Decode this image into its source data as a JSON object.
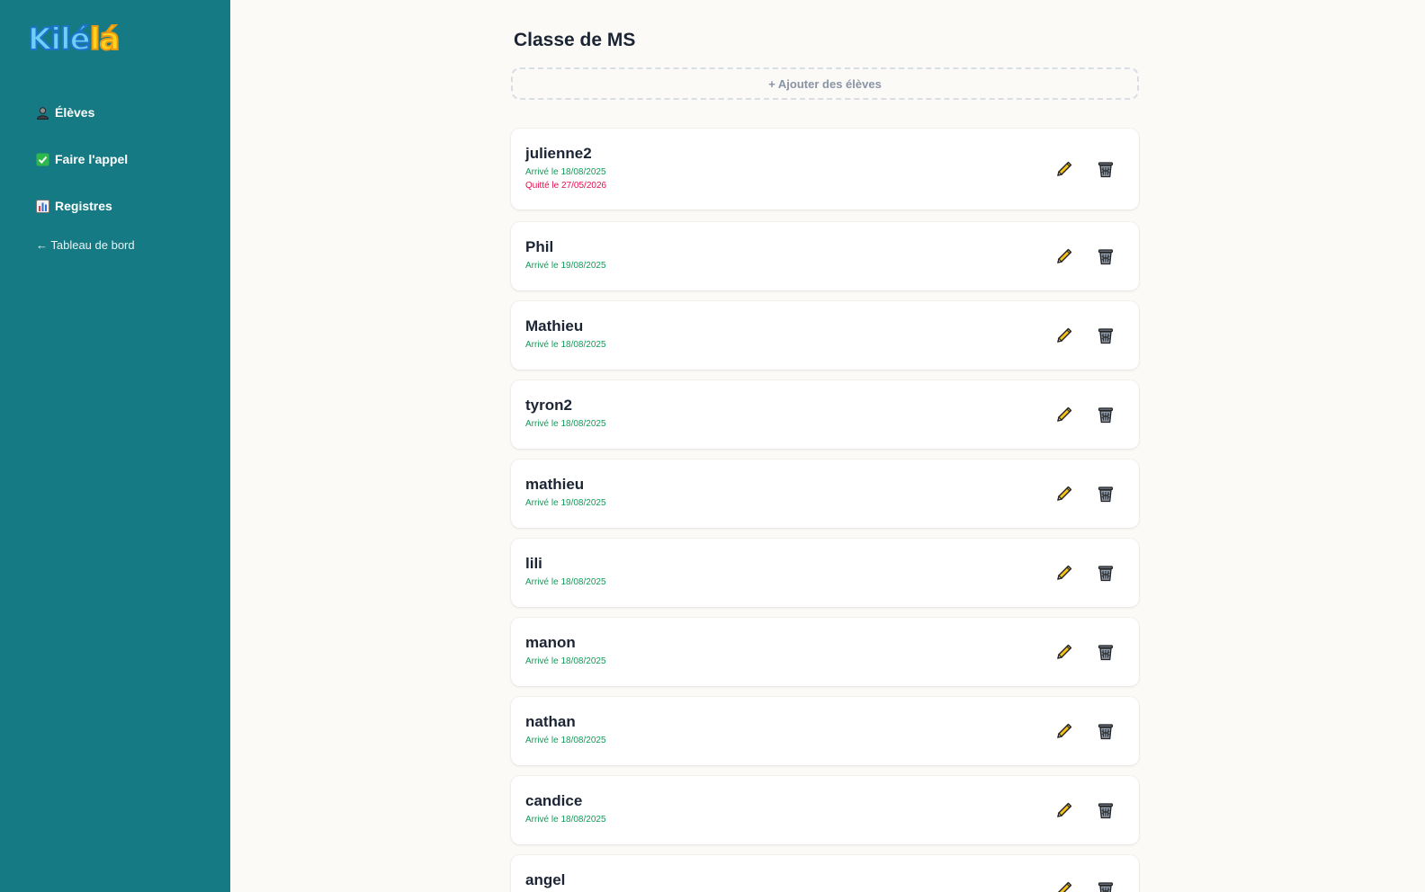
{
  "app": {
    "logo_main": "Kilé",
    "logo_accent": "lá"
  },
  "sidebar": {
    "items": [
      {
        "label": "Élèves",
        "icon": "student-icon"
      },
      {
        "label": "Faire l'appel",
        "icon": "check-box-icon"
      },
      {
        "label": "Registres",
        "icon": "bar-chart-icon"
      }
    ],
    "back_label": "← Tableau de bord"
  },
  "page": {
    "title": "Classe de MS",
    "add_button": "+ Ajouter des élèves"
  },
  "students": [
    {
      "name": "julienne2",
      "arrived": "Arrivé le 18/08/2025",
      "left": "Quitté le 27/05/2026"
    },
    {
      "name": "Phil",
      "arrived": "Arrivé le 19/08/2025"
    },
    {
      "name": "Mathieu",
      "arrived": "Arrivé le 18/08/2025"
    },
    {
      "name": "tyron2",
      "arrived": "Arrivé le 18/08/2025"
    },
    {
      "name": "mathieu",
      "arrived": "Arrivé le 19/08/2025"
    },
    {
      "name": "lili",
      "arrived": "Arrivé le 18/08/2025"
    },
    {
      "name": "manon",
      "arrived": "Arrivé le 18/08/2025"
    },
    {
      "name": "nathan",
      "arrived": "Arrivé le 18/08/2025"
    },
    {
      "name": "candice",
      "arrived": "Arrivé le 18/08/2025"
    },
    {
      "name": "angel",
      "arrived": ""
    }
  ],
  "colors": {
    "sidebar_bg": "#157a83",
    "arrived": "#139b5a",
    "left": "#e0124d",
    "text": "#1b2534"
  }
}
